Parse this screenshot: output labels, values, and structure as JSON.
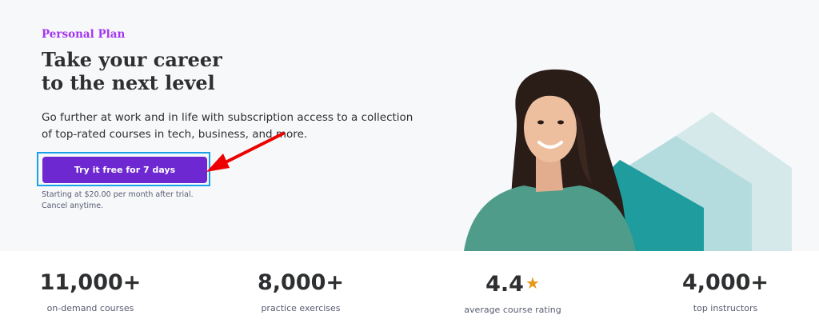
{
  "hero": {
    "eyebrow": "Personal Plan",
    "headline_line1": "Take your career",
    "headline_line2": "to the next level",
    "description": "Go further at work and in life with subscription access to a collection of top-rated courses in tech, business, and more.",
    "cta_label": "Try it free for 7 days",
    "note_line1": "Starting at $20.00 per month after trial.",
    "note_line2": "Cancel anytime.",
    "cta_color": "#6d28d2",
    "accent_color": "#a435f0",
    "arrow_color": "#ee0000",
    "highlight_color": "#1aa0e8"
  },
  "stats": [
    {
      "value": "11,000+",
      "label": "on-demand courses"
    },
    {
      "value": "8,000+",
      "label": "practice exercises"
    },
    {
      "value": "4.4",
      "label": "average course rating",
      "icon": "star-icon"
    },
    {
      "value": "4,000+",
      "label": "top instructors"
    }
  ]
}
